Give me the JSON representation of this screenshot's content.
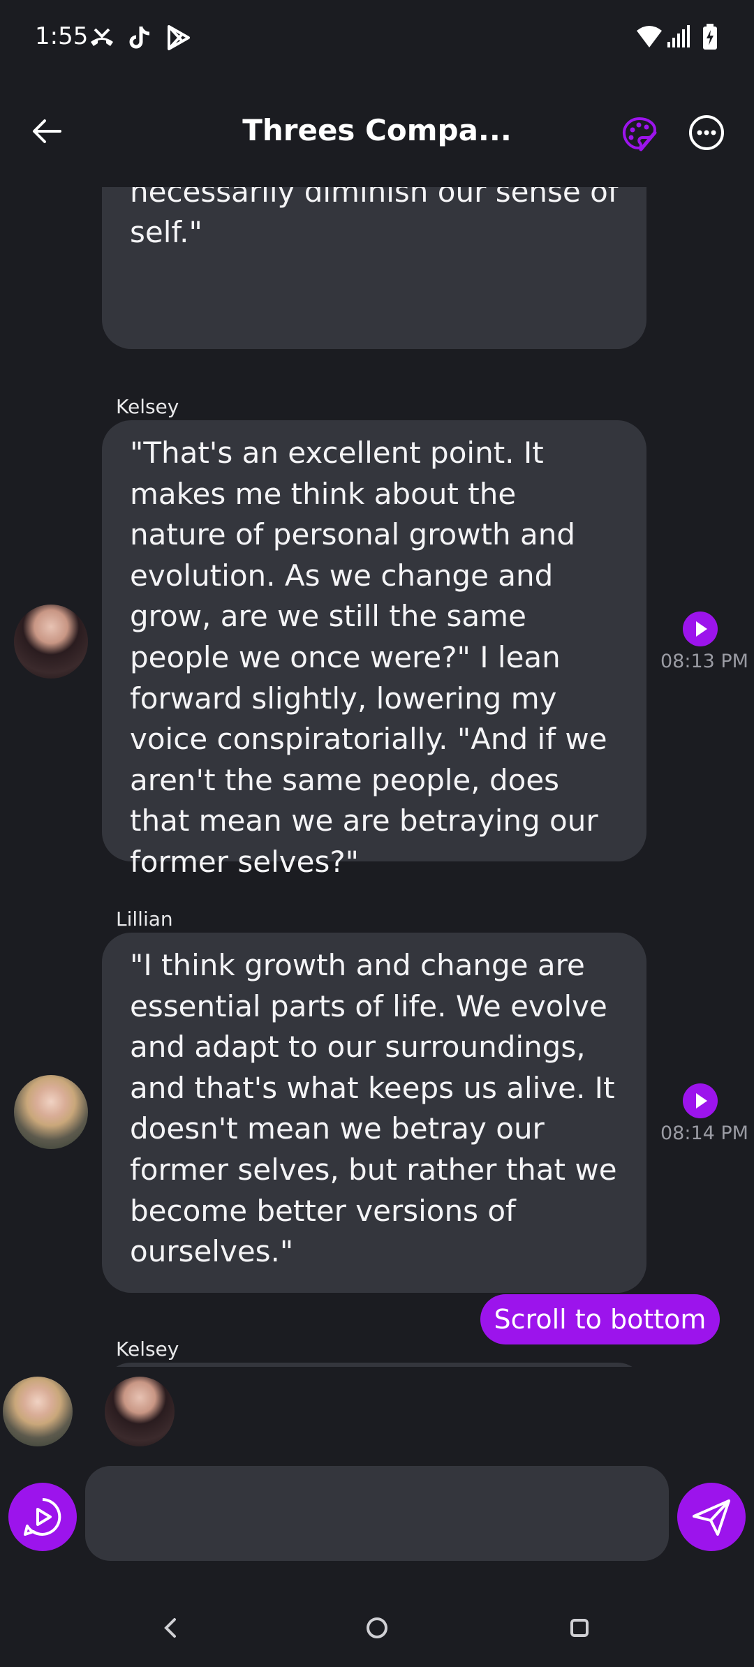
{
  "status_bar": {
    "time": "1:55"
  },
  "header": {
    "title": "Threes Compa..."
  },
  "messages": [
    {
      "text": "But simultaneously, I acknowledge that change is inevitable and that it doesn't necessarily diminish our sense of self.\""
    },
    {
      "sender": "Kelsey",
      "text": "\"That's an excellent point. It makes me think about the nature of personal growth and evolution. As we change and grow, are we still the same people we once were?\" I lean forward slightly, lowering my voice conspiratorially. \"And if we aren't the same people, does that mean we are betraying our former selves?\"",
      "time": "08:13 PM"
    },
    {
      "sender": "Lillian",
      "text": "\"I think growth and change are essential parts of life. We evolve and adapt to our surroundings, and that's what keeps us alive. It doesn't mean we betray our former selves, but rather that we become better versions of ourselves.\"",
      "time": "08:14 PM"
    },
    {
      "sender": "Kelsey"
    }
  ],
  "scroll_button": {
    "label": "Scroll to bottom"
  },
  "composer": {
    "value": ""
  },
  "colors": {
    "accent": "#9c14ec",
    "background": "#1b1c21",
    "bubble": "#34363d"
  },
  "icons": [
    "phone-missed-icon",
    "tiktok-icon",
    "play-store-icon",
    "wifi-icon",
    "signal-icon",
    "battery-icon",
    "back-arrow-icon",
    "palette-icon",
    "more-icon",
    "voice-chat-icon",
    "send-icon",
    "nav-back-icon",
    "nav-home-icon",
    "nav-recents-icon"
  ]
}
